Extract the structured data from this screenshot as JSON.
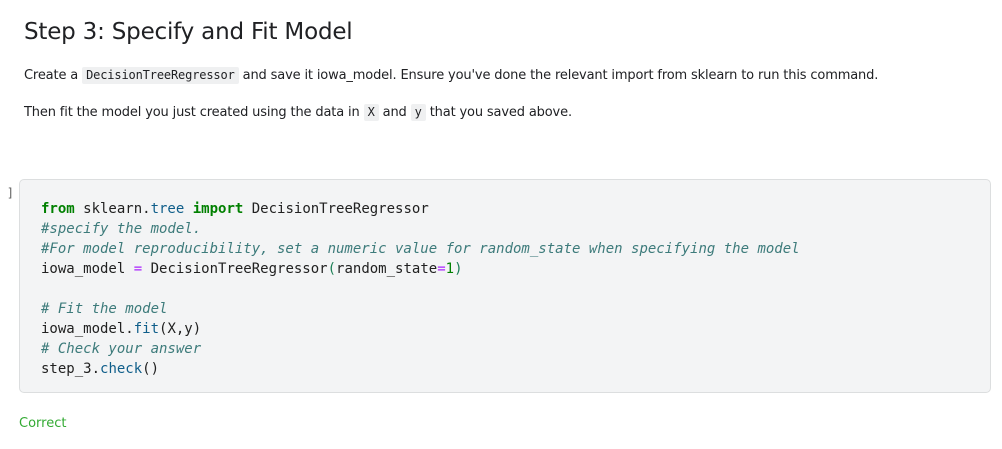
{
  "heading": "Step 3: Specify and Fit Model",
  "para1": {
    "before": "Create a ",
    "code": "DecisionTreeRegressor",
    "after": " and save it iowa_model. Ensure you've done the relevant import from sklearn to run this command."
  },
  "para2": {
    "before": "Then fit the model you just created using the data in ",
    "code_x": "X",
    "middle": " and ",
    "code_y": "y",
    "after": " that you saved above."
  },
  "cell": {
    "prompt": "[ ]:",
    "code": {
      "l1_from": "from",
      "l1_sk": " sklearn.",
      "l1_tree": "tree",
      "l1_space": " ",
      "l1_import": "import",
      "l1_cls": " DecisionTreeRegressor",
      "l2": "#specify the model.",
      "l3": "#For model reproducibility, set a numeric value for random_state when specifying the model",
      "l4_var": "iowa_model ",
      "l4_eq": "=",
      "l4_call": " DecisionTreeRegressor",
      "l4_open": "(",
      "l4_arg": "random_state",
      "l4_eq2": "=",
      "l4_num": "1",
      "l4_close": ")",
      "l6": "# Fit the model",
      "l7_obj": "iowa_model.",
      "l7_fn": "fit",
      "l7_args": "(X,y)",
      "l8": "# Check your answer",
      "l9_obj": "step_3.",
      "l9_fn": "check",
      "l9_args": "()"
    }
  },
  "output": {
    "text": "Correct"
  },
  "colors": {
    "keyword": "#008000",
    "comment": "#3d7b7b",
    "operator": "#aa22ff",
    "output_success": "#33aa33",
    "cell_background": "#f3f4f5"
  }
}
